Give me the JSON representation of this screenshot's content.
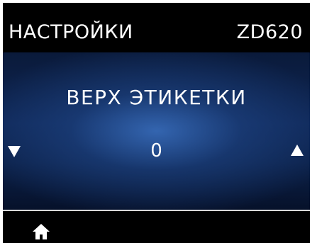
{
  "header": {
    "title": "НАСТРОЙКИ",
    "model": "ZD620"
  },
  "menu": {
    "label": "ВЕРХ ЭТИКЕТКИ",
    "value": "0"
  },
  "icons": {
    "decrease": "down-arrow-icon",
    "increase": "up-arrow-icon",
    "home": "home-icon"
  },
  "colors": {
    "background": "#000000",
    "panel_center": "#3a70c0",
    "panel_edge": "#0a1a3a",
    "text": "#ffffff"
  }
}
